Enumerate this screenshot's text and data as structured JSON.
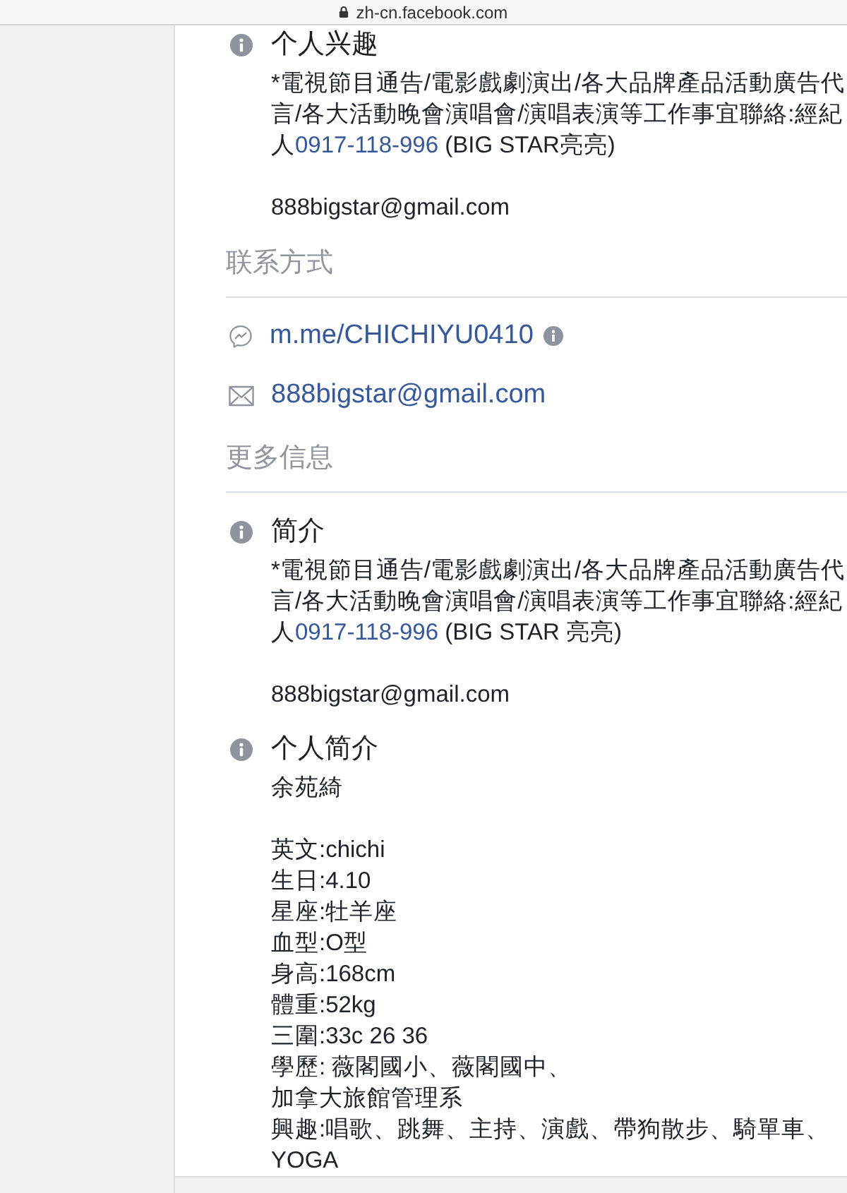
{
  "browser_bar": {
    "url": "zh-cn.facebook.com"
  },
  "sections": [
    {
      "kind": "field",
      "title": "个人兴趣",
      "paragraphs": [
        [
          [
            {
              "kind": "plain",
              "text": "*電視節目通告/電影戲劇演出/各大品牌產品活動廣告代言/各大活動晚會演唱會/演唱表演等工作事宜聯絡:經紀人"
            },
            {
              "kind": "link",
              "text": "0917-118-996"
            },
            {
              "kind": "plain",
              "text": " (BIG STAR亮亮)"
            }
          ]
        ],
        [
          [
            {
              "kind": "plain",
              "text": "888bigstar@gmail.com"
            }
          ]
        ]
      ]
    },
    {
      "kind": "header",
      "title": "联系方式"
    },
    {
      "kind": "contacts",
      "items": [
        {
          "kind": "messenger",
          "text": "m.me/CHICHIYU0410",
          "info_icon": true
        },
        {
          "kind": "email",
          "text": "888bigstar@gmail.com",
          "info_icon": false
        }
      ]
    },
    {
      "kind": "header",
      "title": "更多信息"
    },
    {
      "kind": "field",
      "title": "简介",
      "paragraphs": [
        [
          [
            {
              "kind": "plain",
              "text": "*電視節目通告/電影戲劇演出/各大品牌產品活動廣告代言/各大活動晚會演唱會/演唱表演等工作事宜聯絡:經紀人"
            },
            {
              "kind": "link",
              "text": "0917-118-996"
            },
            {
              "kind": "plain",
              "text": " (BIG STAR 亮亮)"
            }
          ]
        ],
        [
          [
            {
              "kind": "plain",
              "text": "888bigstar@gmail.com"
            }
          ]
        ]
      ]
    },
    {
      "kind": "field",
      "title": "个人简介",
      "paragraphs": [
        [
          [
            {
              "kind": "plain",
              "text": "余苑綺"
            }
          ]
        ],
        [
          [
            {
              "kind": "plain",
              "text": "英文:chichi"
            }
          ],
          [
            {
              "kind": "plain",
              "text": "生日:4.10"
            }
          ],
          [
            {
              "kind": "plain",
              "text": "星座:牡羊座"
            }
          ],
          [
            {
              "kind": "plain",
              "text": "血型:O型"
            }
          ],
          [
            {
              "kind": "plain",
              "text": "身高:168cm"
            }
          ],
          [
            {
              "kind": "plain",
              "text": "體重:52kg"
            }
          ],
          [
            {
              "kind": "plain",
              "text": "三圍:33c 26 36"
            }
          ],
          [
            {
              "kind": "plain",
              "text": "學歷: 薇閣國小、薇閣國中、"
            }
          ],
          [
            {
              "kind": "plain",
              "text": "加拿大旅館管理系"
            }
          ],
          [
            {
              "kind": "plain",
              "text": "興趣:唱歌、跳舞、主持、演戲、帶狗散步、騎單車、YOGA"
            }
          ]
        ]
      ]
    }
  ]
}
